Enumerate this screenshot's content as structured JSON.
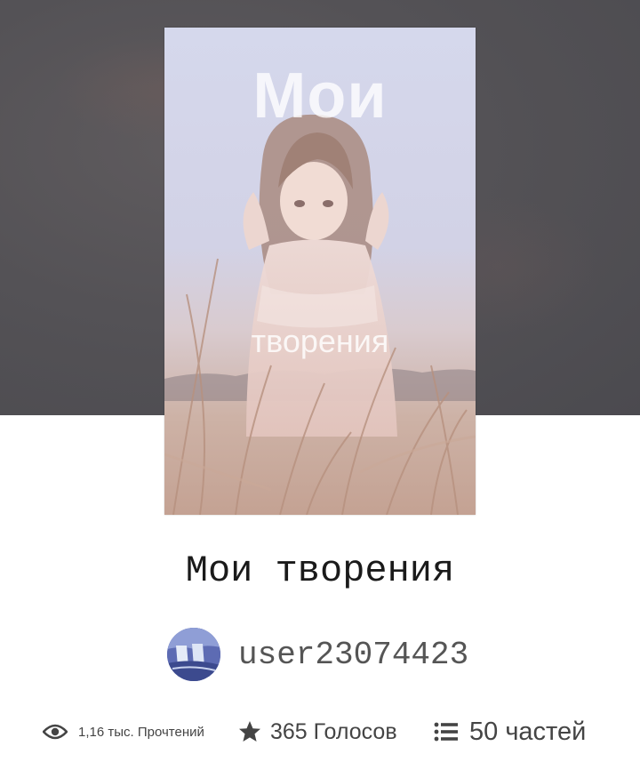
{
  "story": {
    "title": "Мои творения",
    "cover": {
      "title_top": "Мои",
      "title_bottom": "творения"
    }
  },
  "author": {
    "name": "user23074423",
    "avatar_icon": "avatar-waterfall-icon"
  },
  "stats": {
    "reads": {
      "icon": "eye-icon",
      "label": "1,16 тыс. Прочтений"
    },
    "votes": {
      "icon": "star-icon",
      "label": "365 Голосов"
    },
    "parts": {
      "icon": "list-icon",
      "label": "50 частей"
    }
  },
  "colors": {
    "hero_background": "#545256",
    "text_primary": "#1a1a1a",
    "text_secondary": "#555555",
    "icon": "#444444"
  }
}
